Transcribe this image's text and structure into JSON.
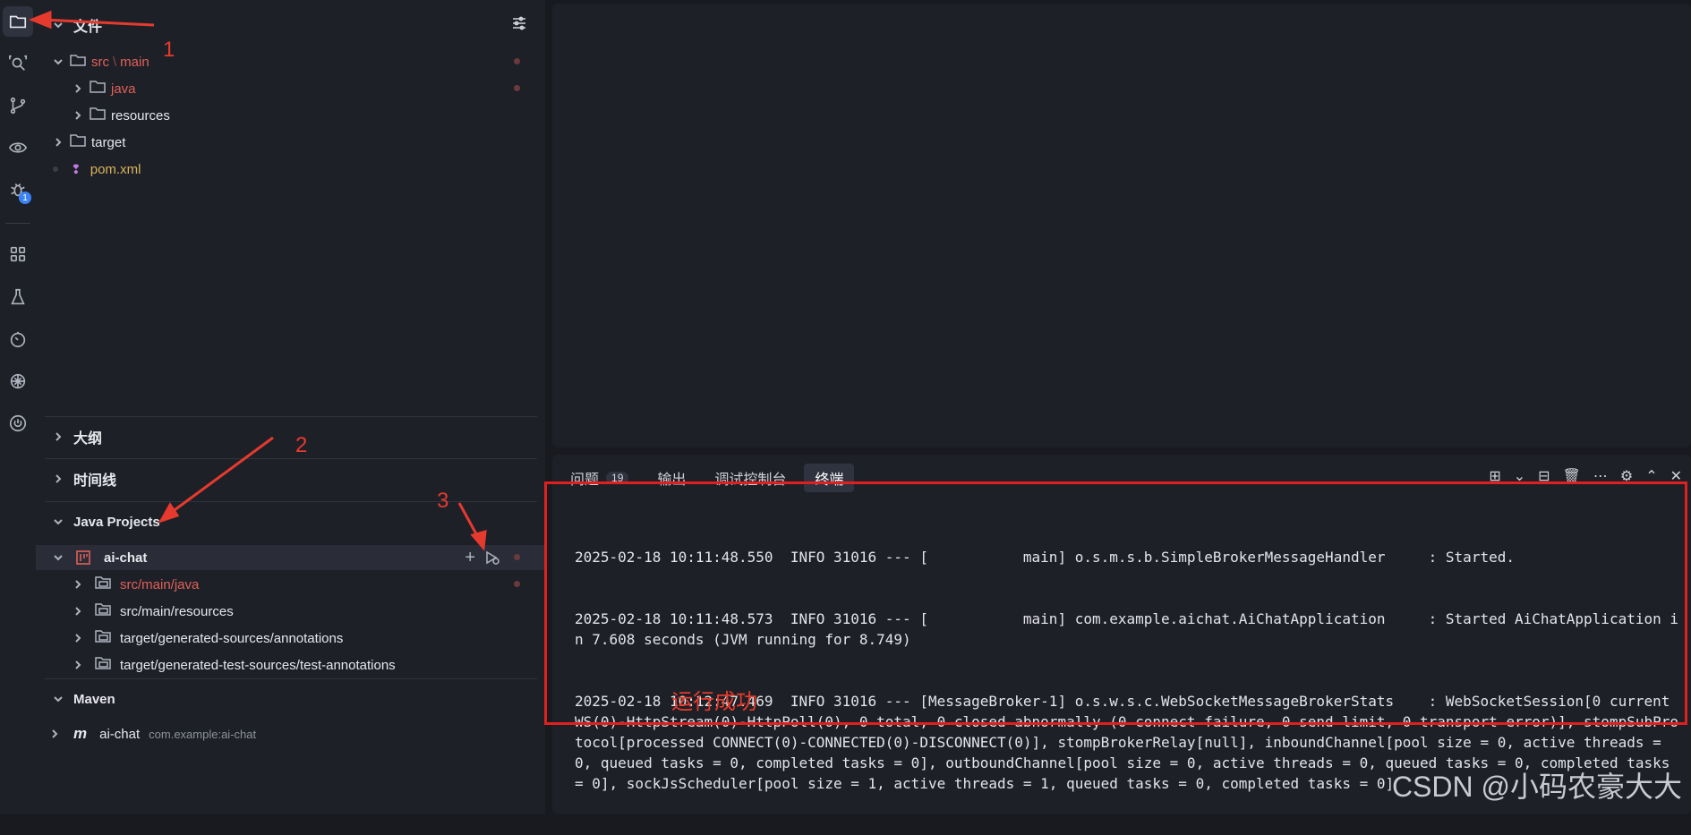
{
  "activity_bar": {
    "icons": [
      "folder-icon",
      "search-code-icon",
      "branch-icon",
      "eye-icon",
      "debug-icon",
      "extensions-icon",
      "test-flask-icon",
      "timer-icon",
      "ai-icon",
      "power-icon"
    ],
    "debug_badge": "1"
  },
  "explorer": {
    "files_header": "文件",
    "tree": {
      "src_main_part1": "src",
      "src_main_sep": "\\",
      "src_main_part2": "main",
      "java": "java",
      "resources": "resources",
      "target": "target",
      "pom": "pom.xml"
    },
    "outline": "大纲",
    "timeline": "时间线",
    "java_projects": {
      "header": "Java Projects",
      "project": "ai-chat",
      "folders": [
        "src/main/java",
        "src/main/resources",
        "target/generated-sources/annotations",
        "target/generated-test-sources/test-annotations"
      ]
    },
    "maven": {
      "header": "Maven",
      "project": "ai-chat",
      "coords": "com.example:ai-chat"
    }
  },
  "panel": {
    "tabs": {
      "problems": "问题",
      "problems_count": "19",
      "output": "输出",
      "debug_console": "调试控制台",
      "terminal": "终端"
    },
    "terminal_lines": [
      "2025-02-18 10:11:48.550  INFO 31016 --- [           main] o.s.m.s.b.SimpleBrokerMessageHandler     : Started.",
      "2025-02-18 10:11:48.573  INFO 31016 --- [           main] com.example.aichat.AiChatApplication     : Started AiChatApplication in 7.608 seconds (JVM running for 8.749)",
      "2025-02-18 10:12:47.469  INFO 31016 --- [MessageBroker-1] o.s.w.s.c.WebSocketMessageBrokerStats    : WebSocketSession[0 current WS(0)-HttpStream(0)-HttpPoll(0), 0 total, 0 closed abnormally (0 connect failure, 0 send limit, 0 transport error)], stompSubProtocol[processed CONNECT(0)-CONNECTED(0)-DISCONNECT(0)], stompBrokerRelay[null], inboundChannel[pool size = 0, active threads = 0, queued tasks = 0, completed tasks = 0], outboundChannel[pool size = 0, active threads = 0, queued tasks = 0, completed tasks = 0], sockJsScheduler[pool size = 1, active threads = 1, queued tasks = 0, completed tasks = 0]"
    ]
  },
  "annotations": {
    "n1": "1",
    "n2": "2",
    "n3": "3",
    "success": "运行成功",
    "color": "#e63a2e"
  },
  "watermark": "CSDN @小码农豪大大"
}
